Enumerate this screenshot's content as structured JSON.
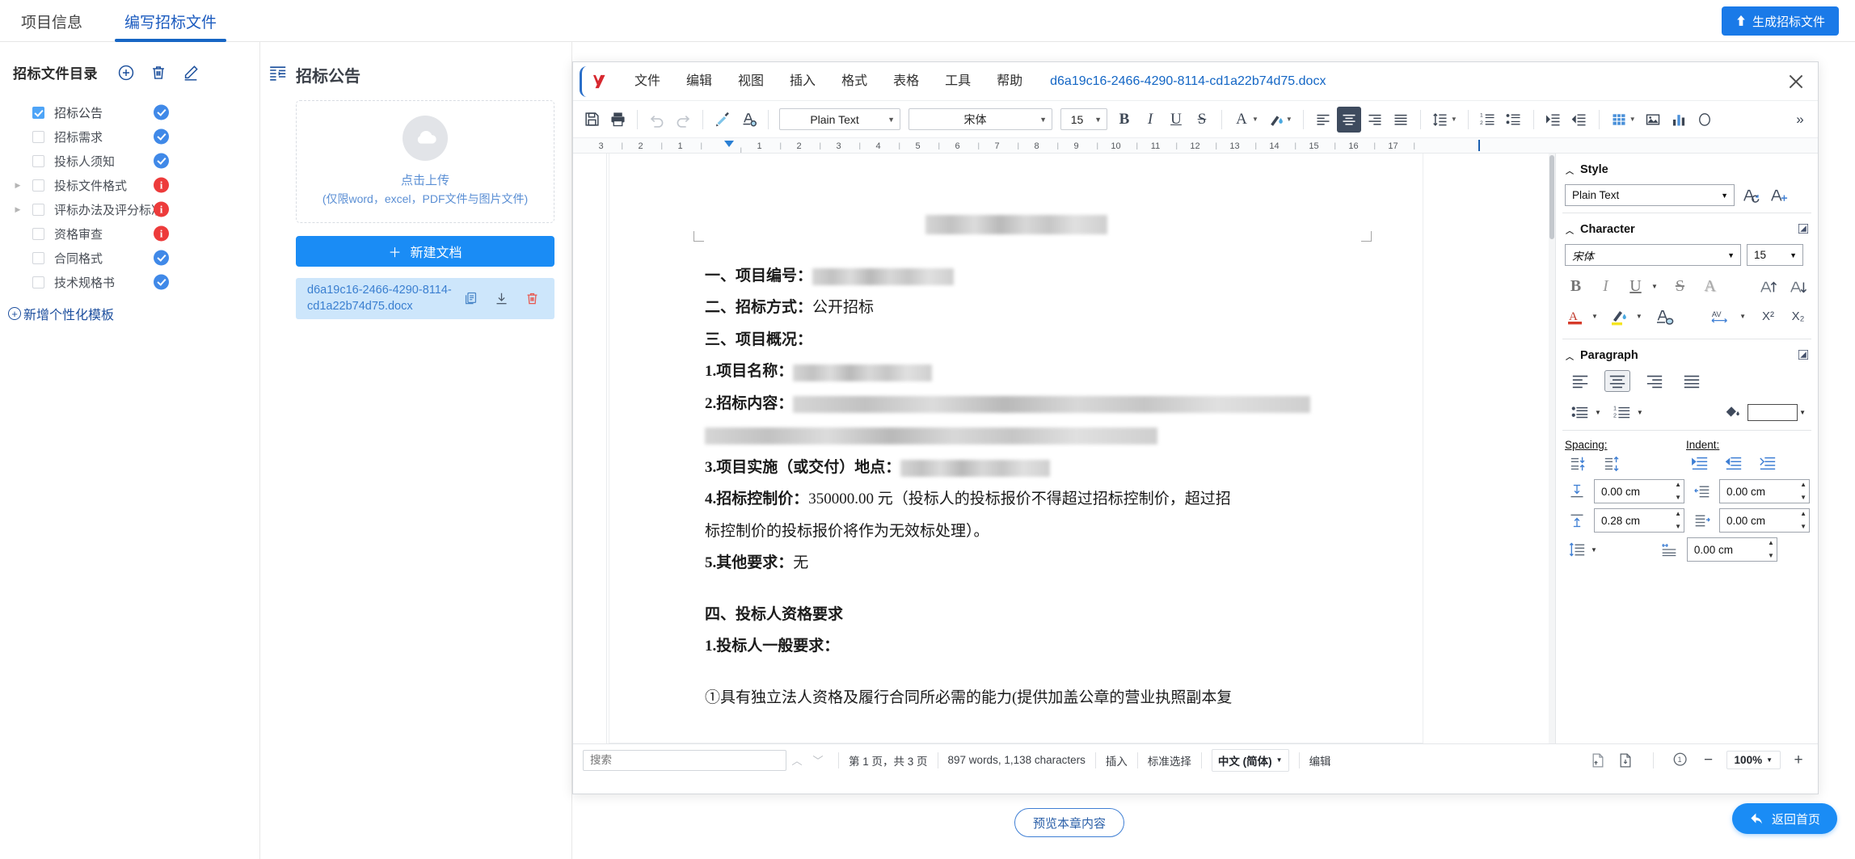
{
  "topbar": {
    "tabs": [
      {
        "label": "项目信息",
        "active": false
      },
      {
        "label": "编写招标文件",
        "active": true
      }
    ],
    "generate_button": {
      "label": "生成招标文件",
      "icon": "upload-icon"
    },
    "accent_color": "#1766c4",
    "primary_button_color": "#1a7ae8"
  },
  "sidebar": {
    "title": "招标文件目录",
    "actions": [
      {
        "name": "add-icon",
        "tooltip": "新增"
      },
      {
        "name": "delete-icon",
        "tooltip": "删除"
      },
      {
        "name": "edit-icon",
        "tooltip": "编辑"
      }
    ],
    "items": [
      {
        "label": "招标公告",
        "checked": true,
        "expandable": false,
        "status": "ok"
      },
      {
        "label": "招标需求",
        "checked": false,
        "expandable": false,
        "status": "ok"
      },
      {
        "label": "投标人须知",
        "checked": false,
        "expandable": false,
        "status": "ok"
      },
      {
        "label": "投标文件格式",
        "checked": false,
        "expandable": true,
        "status": "warn"
      },
      {
        "label": "评标办法及评分标准",
        "checked": false,
        "expandable": true,
        "status": "warn"
      },
      {
        "label": "资格审查",
        "checked": false,
        "expandable": false,
        "status": "warn"
      },
      {
        "label": "合同格式",
        "checked": false,
        "expandable": false,
        "status": "ok"
      },
      {
        "label": "技术规格书",
        "checked": false,
        "expandable": false,
        "status": "ok"
      }
    ],
    "add_template": "新增个性化模板",
    "status_ok_color": "#4089e8",
    "status_warn_color": "#ed3b3b"
  },
  "midpanel": {
    "collapse_icon": "panel-collapse-icon",
    "title": "招标公告",
    "upload": {
      "icon": "cloud-upload-icon",
      "line1": "点击上传",
      "line2": "(仅限word，excel，PDF文件与图片文件)"
    },
    "new_doc_button": "新建文档",
    "files": [
      {
        "name": "d6a19c16-2466-4290-8114-cd1a22b74d75.docx",
        "actions": [
          "copy-icon",
          "download-icon",
          "delete-icon"
        ],
        "selected": true
      }
    ]
  },
  "editor": {
    "logo": "wps-logo-icon",
    "menu": [
      "文件",
      "编辑",
      "视图",
      "插入",
      "格式",
      "表格",
      "工具",
      "帮助"
    ],
    "doc_title": "d6a19c16-2466-4290-8114-cd1a22b74d75.docx",
    "close_icon": "close-icon",
    "toolbar": {
      "save_icon": "save-icon",
      "print_icon": "print-icon",
      "undo_icon": "undo-icon",
      "redo_icon": "redo-icon",
      "format_painter_icon": "format-painter-icon",
      "clear_format_icon": "clear-format-icon",
      "style_value": "Plain Text",
      "font_value": "宋体",
      "size_value": "15",
      "bold_icon": "bold-icon",
      "italic_icon": "italic-icon",
      "underline_icon": "underline-icon",
      "strike_icon": "strikethrough-icon",
      "font_color_icon": "font-color-icon",
      "highlight_icon": "highlight-color-icon",
      "align_left_icon": "align-left-icon",
      "align_center_icon": "align-center-icon",
      "align_right_icon": "align-right-icon",
      "align_justify_icon": "align-justify-icon",
      "line_spacing_icon": "line-spacing-icon",
      "ordered_list_icon": "ordered-list-icon",
      "unordered_list_icon": "unordered-list-icon",
      "indent_inc_icon": "increase-indent-icon",
      "indent_dec_icon": "decrease-indent-icon",
      "table_icon": "insert-table-icon",
      "image_icon": "insert-image-icon",
      "chart_icon": "insert-chart-icon",
      "shape_icon": "insert-shape-icon",
      "more_icon": "chevron-right-more-icon"
    },
    "ruler": {
      "left_ticks": [
        "3",
        "2",
        "1"
      ],
      "right_ticks": [
        "1",
        "2",
        "3",
        "4",
        "5",
        "6",
        "7",
        "8",
        "9",
        "10",
        "11",
        "12",
        "13",
        "14",
        "15",
        "16",
        "17"
      ]
    },
    "document": {
      "heading_redacted": true,
      "lines": [
        {
          "bold": "一、项目编号：",
          "text": "",
          "redacted_after": 175
        },
        {
          "bold": "二、招标方式：",
          "text": "公开招标",
          "redacted_after": 0
        },
        {
          "bold": "三、项目概况：",
          "text": "",
          "redacted_after": 0
        },
        {
          "bold": "1.项目名称：",
          "text": "",
          "redacted_after": 175
        },
        {
          "bold": "2.招标内容：",
          "text": "",
          "redacted_after": 640
        },
        {
          "bold": "",
          "text": "",
          "redacted_after": 560
        },
        {
          "bold": "3.项目实施（或交付）地点：",
          "text": "",
          "redacted_after": 185
        },
        {
          "bold": "4.招标控制价：",
          "text": "350000.00 元（投标人的投标报价不得超过招标控制价，超过招",
          "redacted_after": 0
        },
        {
          "bold": "",
          "text": "标控制价的投标报价将作为无效标处理）。",
          "redacted_after": 0
        },
        {
          "bold": "5.其他要求：",
          "text": "无",
          "redacted_after": 0
        },
        {
          "bold": "四、投标人资格要求",
          "text": "",
          "redacted_after": 0
        },
        {
          "bold": "1.投标人一般要求：",
          "text": "",
          "redacted_after": 0
        },
        {
          "bold": "",
          "text": "①具有独立法人资格及履行合同所必需的能力(提供加盖公章的营业执照副本复",
          "redacted_after": 0
        }
      ]
    },
    "sidepanel": {
      "style": {
        "header": "Style",
        "value": "Plain Text",
        "update_style_icon": "update-style-icon",
        "new_style_icon": "new-style-icon"
      },
      "character": {
        "header": "Character",
        "font": "宋体",
        "size": "15",
        "bold_icon": "bold-icon",
        "italic_icon": "italic-icon",
        "underline_icon": "underline-icon",
        "strike_icon": "strikethrough-icon",
        "shadow_icon": "text-shadow-icon",
        "grow_font_icon": "increase-font-size-icon",
        "shrink_font_icon": "decrease-font-size-icon",
        "font_color_icon": "font-color-icon",
        "highlight_icon": "highlight-color-icon",
        "clear_format_icon": "clear-formatting-icon",
        "spacing_icon": "character-spacing-icon",
        "superscript_icon": "superscript-icon",
        "subscript_icon": "subscript-icon",
        "sup_label": "X²",
        "sub_label": "X₂",
        "av_label": "AV"
      },
      "paragraph": {
        "header": "Paragraph",
        "align_left_icon": "align-left-icon",
        "align_center_icon": "align-center-icon",
        "align_right_icon": "align-right-icon",
        "align_justify_icon": "align-justify-icon",
        "bullet_list_icon": "bullet-list-icon",
        "numbered_list_icon": "numbered-list-icon",
        "background_color_icon": "paragraph-background-color-icon",
        "spacing_label": "Spacing:",
        "indent_label": "Indent:",
        "spacing_above_icon": "increase-space-above-icon",
        "spacing_below_icon": "decrease-space-below-icon",
        "indent_inc_icon": "increase-indent-icon",
        "indent_dec_icon": "decrease-indent-icon",
        "indent_hanging_icon": "hanging-indent-icon",
        "line_spacing_icon": "line-spacing-icon",
        "spacing_above_value": "0.00 cm",
        "spacing_below_value": "0.28 cm",
        "indent_before_value": "0.00 cm",
        "indent_after_value": "0.00 cm",
        "indent_first_line_value": "0.00 cm"
      }
    },
    "statusbar": {
      "search_placeholder": "搜索",
      "search_value": "",
      "find_prev_icon": "chevron-up-icon",
      "find_next_icon": "chevron-down-icon",
      "page_info": "第 1 页，共 3 页",
      "word_count": "897 words, 1,138 characters",
      "insert_mode": "插入",
      "selection_mode": "标准选择",
      "language": "中文 (简体)",
      "edit_mode": "编辑",
      "single_page_icon": "single-page-view-icon",
      "multi_page_icon": "multi-page-view-icon",
      "book_view_icon": "book-view-icon",
      "zoom_out_icon": "zoom-out-icon",
      "zoom_in_icon": "zoom-in-icon",
      "zoom_level": "100%"
    }
  },
  "footer": {
    "preview_button": "预览本章内容",
    "home_button": {
      "label": "返回首页",
      "icon": "back-arrow-icon"
    }
  }
}
